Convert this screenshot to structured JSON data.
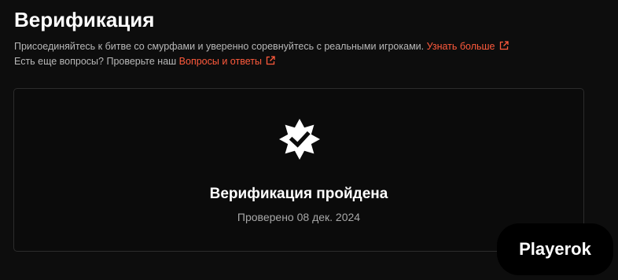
{
  "header": {
    "title": "Верификация"
  },
  "description": {
    "line1_text": "Присоединяйтесь к битве со смурфами и уверенно соревнуйтесь с реальными игроками.",
    "line1_link": "Узнать больше",
    "line2_text": "Есть еще вопросы? Проверьте наш",
    "line2_link": "Вопросы и ответы"
  },
  "verification_card": {
    "badge_icon": "verified-badge-icon",
    "status": "Верификация пройдена",
    "date": "Проверено 08 дек. 2024"
  },
  "watermark": {
    "text": "Playerok"
  },
  "colors": {
    "background": "#0d0d0d",
    "accent_link": "#ff5a3c",
    "card_border": "#2c2c2c",
    "text_primary": "#ffffff",
    "text_secondary": "#b8b8b8"
  }
}
